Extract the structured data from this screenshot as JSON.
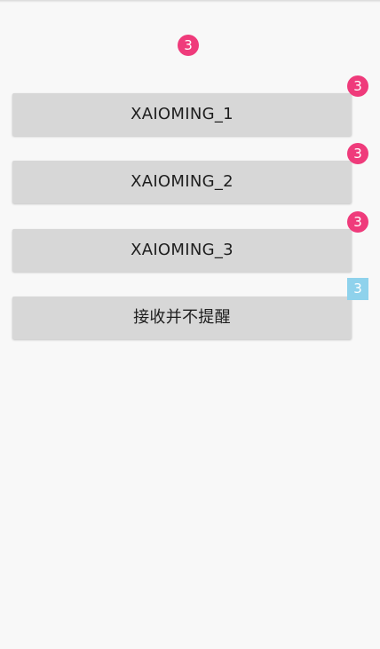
{
  "top_badge": {
    "count": "3"
  },
  "buttons": [
    {
      "label": "XAIOMING_1",
      "badge": "3"
    },
    {
      "label": "XAIOMING_2",
      "badge": "3"
    },
    {
      "label": "XAIOMING_3",
      "badge": "3"
    },
    {
      "label": "接收并不提醒",
      "badge": "3"
    }
  ],
  "colors": {
    "background": "#f8f8f8",
    "button": "#d7d7d7",
    "badge_pink": "#ef3b7b",
    "badge_blue": "#8fd2ec"
  }
}
